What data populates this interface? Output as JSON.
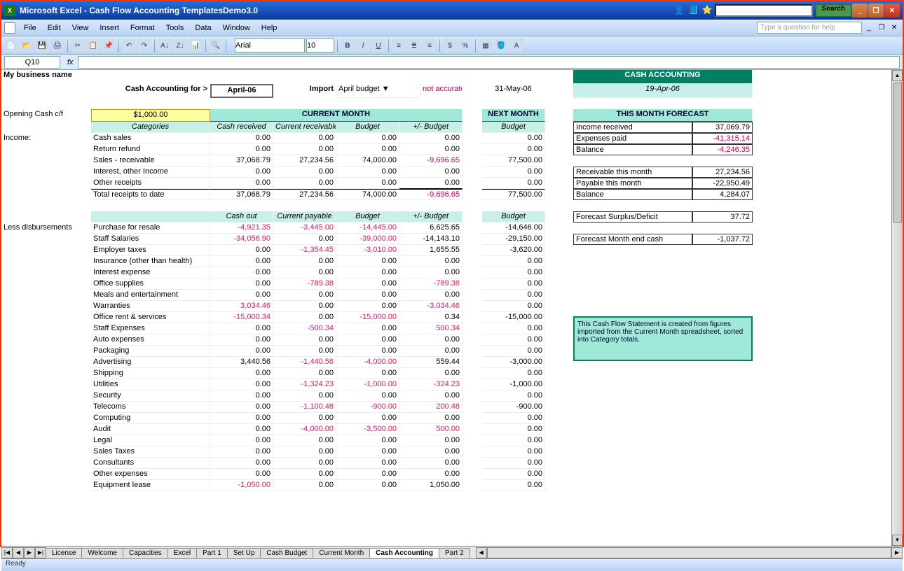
{
  "title": "Microsoft Excel - Cash Flow Accounting TemplatesDemo3.0",
  "search_btn": "Search",
  "help_placeholder": "Type a question for help",
  "menu": [
    "File",
    "Edit",
    "View",
    "Insert",
    "Format",
    "Tools",
    "Data",
    "Window",
    "Help"
  ],
  "font": "Arial",
  "fontsize": "10",
  "namebox": "Q10",
  "business": "My business name",
  "acct_for_label": "Cash Accounting for >",
  "period": "April-06",
  "import_label": "Import",
  "import_select": "April budget",
  "not_accurate": "not accurate",
  "next_date": "31-May-06",
  "green_hdr": "CASH ACCOUNTING",
  "as_of": "19-Apr-06",
  "opening_label": "Opening Cash c/f",
  "opening_value": "$1,000.00",
  "cur_month": "CURRENT MONTH",
  "next_month": "NEXT MONTH",
  "cols_income": [
    "Categories",
    "Cash received",
    "Current receivable",
    "Budget",
    "+/- Budget",
    "Budget"
  ],
  "income_label": "Income:",
  "income_rows": [
    {
      "n": "Cash sales",
      "v": [
        "0.00",
        "0.00",
        "0.00",
        "0.00",
        "0.00"
      ]
    },
    {
      "n": "Return refund",
      "v": [
        "0.00",
        "0.00",
        "0.00",
        "0.00",
        "0.00"
      ]
    },
    {
      "n": "Sales - receivable",
      "v": [
        "37,068.79",
        "27,234.56",
        "74,000.00",
        "-9,696.65",
        "77,500.00"
      ],
      "redcol": 4
    },
    {
      "n": "Interest, other Income",
      "v": [
        "0.00",
        "0.00",
        "0.00",
        "0.00",
        "0.00"
      ]
    },
    {
      "n": "Other receipts",
      "v": [
        "0.00",
        "0.00",
        "0.00",
        "0.00",
        "0.00"
      ]
    }
  ],
  "income_total": {
    "n": "Total receipts to date",
    "v": [
      "37,068.79",
      "27,234.56",
      "74,000.00",
      "-9,696.65",
      "77,500.00"
    ]
  },
  "cols_disb": [
    "",
    "Cash out",
    "Current payable",
    "Budget",
    "+/- Budget",
    "Budget"
  ],
  "disb_label": "Less disbursements",
  "disb_rows": [
    {
      "n": "Purchase for resale",
      "v": [
        "-4,921.35",
        "-3,445.00",
        "-14,445.00",
        "6,625.65",
        "-14,646.00"
      ],
      "r": [
        1,
        2,
        3
      ]
    },
    {
      "n": "Staff Salaries",
      "v": [
        "-34,056.90",
        "0.00",
        "-39,000.00",
        "-14,143.10",
        "-29,150.00"
      ],
      "r": [
        1,
        3
      ]
    },
    {
      "n": "Employer taxes",
      "v": [
        "0.00",
        "-1,354.45",
        "-3,010.00",
        "1,655.55",
        "-3,620.00"
      ],
      "r": [
        2,
        3
      ]
    },
    {
      "n": "Insurance (other than health)",
      "v": [
        "0.00",
        "0.00",
        "0.00",
        "0.00",
        "0.00"
      ]
    },
    {
      "n": "Interest expense",
      "v": [
        "0.00",
        "0.00",
        "0.00",
        "0.00",
        "0.00"
      ]
    },
    {
      "n": "Office supplies",
      "v": [
        "0.00",
        "-789.38",
        "0.00",
        "-789.38",
        "0.00"
      ],
      "r": [
        2,
        4
      ]
    },
    {
      "n": "Meals and entertainment",
      "v": [
        "0.00",
        "0.00",
        "0.00",
        "0.00",
        "0.00"
      ]
    },
    {
      "n": "Warranties",
      "v": [
        "3,034.46",
        "0.00",
        "0.00",
        "-3,034.46",
        "0.00"
      ],
      "r": [
        1,
        4
      ]
    },
    {
      "n": "Office rent & services",
      "v": [
        "-15,000.34",
        "0.00",
        "-15,000.00",
        "0.34",
        "-15,000.00"
      ],
      "r": [
        1,
        3
      ]
    },
    {
      "n": "Staff Expenses",
      "v": [
        "0.00",
        "-500.34",
        "0.00",
        "500.34",
        "0.00"
      ],
      "r": [
        2,
        4
      ]
    },
    {
      "n": "Auto expenses",
      "v": [
        "0.00",
        "0.00",
        "0.00",
        "0.00",
        "0.00"
      ]
    },
    {
      "n": "Packaging",
      "v": [
        "0.00",
        "0.00",
        "0.00",
        "0.00",
        "0.00"
      ]
    },
    {
      "n": "Advertising",
      "v": [
        "3,440.56",
        "-1,440.56",
        "-4,000.00",
        "559.44",
        "-3,000.00"
      ],
      "r": [
        2,
        3
      ]
    },
    {
      "n": "Shipping",
      "v": [
        "0.00",
        "0.00",
        "0.00",
        "0.00",
        "0.00"
      ]
    },
    {
      "n": "Utilities",
      "v": [
        "0.00",
        "-1,324.23",
        "-1,000.00",
        "-324.23",
        "-1,000.00"
      ],
      "r": [
        2,
        3,
        4
      ]
    },
    {
      "n": "Security",
      "v": [
        "0.00",
        "0.00",
        "0.00",
        "0.00",
        "0.00"
      ]
    },
    {
      "n": "Telecoms",
      "v": [
        "0.00",
        "-1,100.48",
        "-900.00",
        "200.48",
        "-900.00"
      ],
      "r": [
        2,
        3,
        4
      ]
    },
    {
      "n": "Computing",
      "v": [
        "0.00",
        "0.00",
        "0.00",
        "0.00",
        "0.00"
      ]
    },
    {
      "n": "Audit",
      "v": [
        "0.00",
        "-4,000.00",
        "-3,500.00",
        "500.00",
        "0.00"
      ],
      "r": [
        2,
        3,
        4
      ]
    },
    {
      "n": "Legal",
      "v": [
        "0.00",
        "0.00",
        "0.00",
        "0.00",
        "0.00"
      ]
    },
    {
      "n": "Sales Taxes",
      "v": [
        "0.00",
        "0.00",
        "0.00",
        "0.00",
        "0.00"
      ]
    },
    {
      "n": "Consultants",
      "v": [
        "0.00",
        "0.00",
        "0.00",
        "0.00",
        "0.00"
      ]
    },
    {
      "n": "Other expenses",
      "v": [
        "0.00",
        "0.00",
        "0.00",
        "0.00",
        "0.00"
      ]
    },
    {
      "n": "Equipment lease",
      "v": [
        "-1,050.00",
        "0.00",
        "0.00",
        "1,050.00",
        "0.00"
      ],
      "r": [
        1
      ]
    }
  ],
  "forecast": {
    "title": "THIS MONTH FORECAST",
    "rows1": [
      [
        "Income received",
        "37,069.79",
        ""
      ],
      [
        "Expenses paid",
        "-41,315.14",
        "red"
      ],
      [
        "Balance",
        "-4,246.35",
        "red"
      ]
    ],
    "rows2": [
      [
        "Receivable this month",
        "27,234.56",
        ""
      ],
      [
        "Payable this month",
        "-22,950.49",
        ""
      ],
      [
        "Balance",
        "4,284.07",
        ""
      ]
    ],
    "surplus": [
      "Forecast Surplus/Deficit",
      "37.72"
    ],
    "endcash": [
      "Forecast Month end cash",
      "-1,037.72"
    ]
  },
  "info_text": "This Cash Flow Statement is created from figures imported from the Current Month spreadsheet, sorted into Category totals.",
  "tabs": [
    "License",
    "Welcome",
    "Capacities",
    "Excel",
    "Part 1",
    "Set Up",
    "Cash Budget",
    "Current Month",
    "Cash Accounting",
    "Part 2"
  ],
  "active_tab": 8,
  "status": "Ready"
}
